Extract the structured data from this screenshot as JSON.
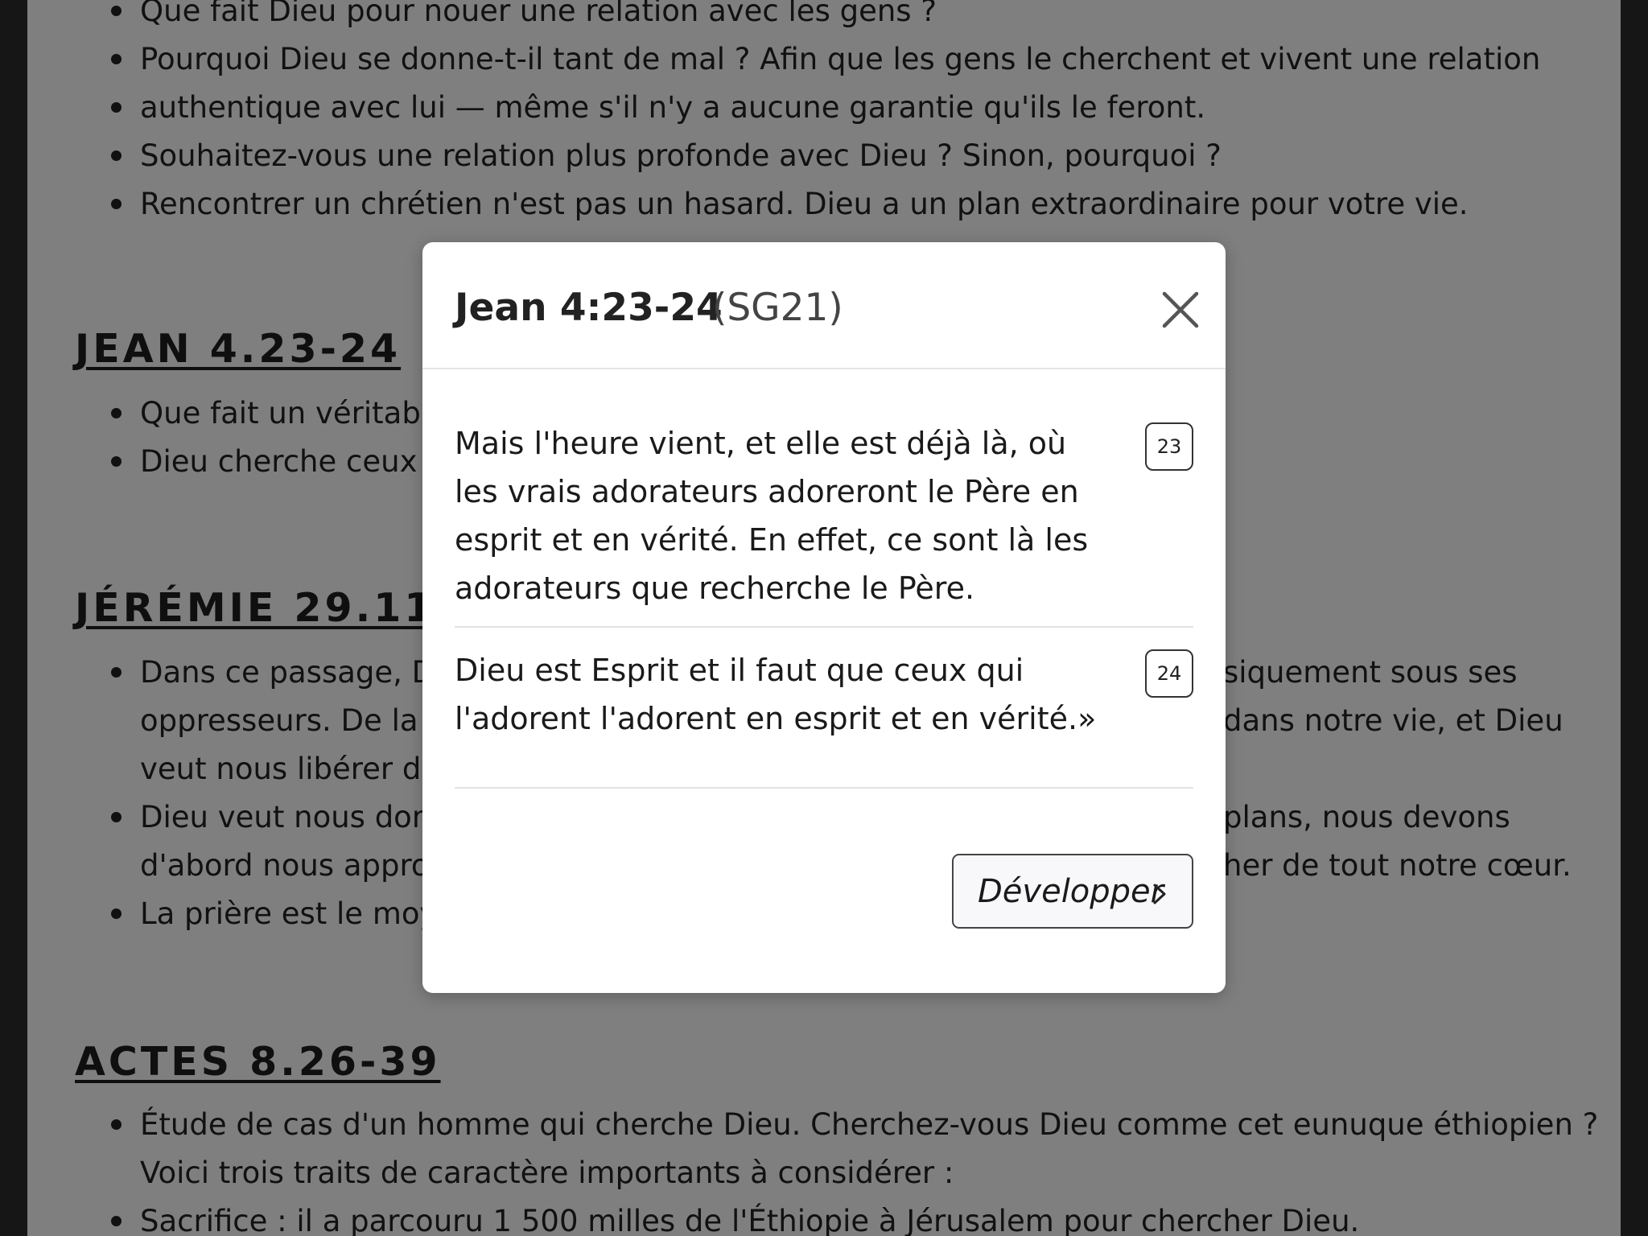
{
  "background": {
    "top_list": [
      "Que fait Dieu pour nouer une relation avec les gens ?",
      "Pourquoi Dieu se donne-t-il tant de mal ? Afin que les gens le cherchent et vivent une relation",
      "authentique avec lui — même s'il n'y a aucune garantie qu'ils le feront.",
      "Souhaitez-vous une relation plus profonde avec Dieu ? Sinon, pourquoi ?",
      "Rencontrer un chrétien n'est pas un hasard. Dieu a un plan extraordinaire pour votre vie."
    ],
    "jean": {
      "heading": "JEAN 4.23-24",
      "items": [
        "Que fait un véritable",
        "Dieu cherche ceux q"
      ]
    },
    "jeremie": {
      "heading": "JÉRÉMIE 29.11-",
      "lines": [
        {
          "left": "Dans ce passage, Di",
          "right": "siquement sous ses"
        },
        {
          "left": "oppresseurs. De la m",
          "right": "dans notre vie, et Dieu"
        },
        {
          "left": "veut nous libérer de",
          "right": ""
        },
        {
          "left": "Dieu veut nous donn",
          "right": "plans, nous devons"
        },
        {
          "left": "d'abord nous appro",
          "right": "her de tout notre cœur."
        },
        {
          "left": "La prière est le moye",
          "right": ""
        }
      ]
    },
    "actes": {
      "heading": "ACTES 8.26-39",
      "items": [
        "Étude de cas d'un homme qui cherche Dieu. Cherchez-vous Dieu comme cet eunuque éthiopien ?",
        "Voici trois traits de caractère importants à considérer :",
        "Sacrifice : il a parcouru 1 500 milles de l'Éthiopie à Jérusalem pour chercher Dieu."
      ]
    }
  },
  "modal": {
    "title": "Jean 4:23-24",
    "version": "(SG21)",
    "close_icon": "close-x-icon",
    "verses": [
      {
        "number": "23",
        "text": "Mais l'heure vient, et elle est déjà là, où les vrais adorateurs adoreront le Père en esprit et en vérité. En effet, ce sont là les adorateurs que recherche le Père."
      },
      {
        "number": "24",
        "text": "Dieu est Esprit et il faut que ceux qui l'adorent l'adorent en esprit et en vérité.»"
      }
    ],
    "expand_button": "Développer",
    "expand_icon": "chevron-right-icon"
  }
}
